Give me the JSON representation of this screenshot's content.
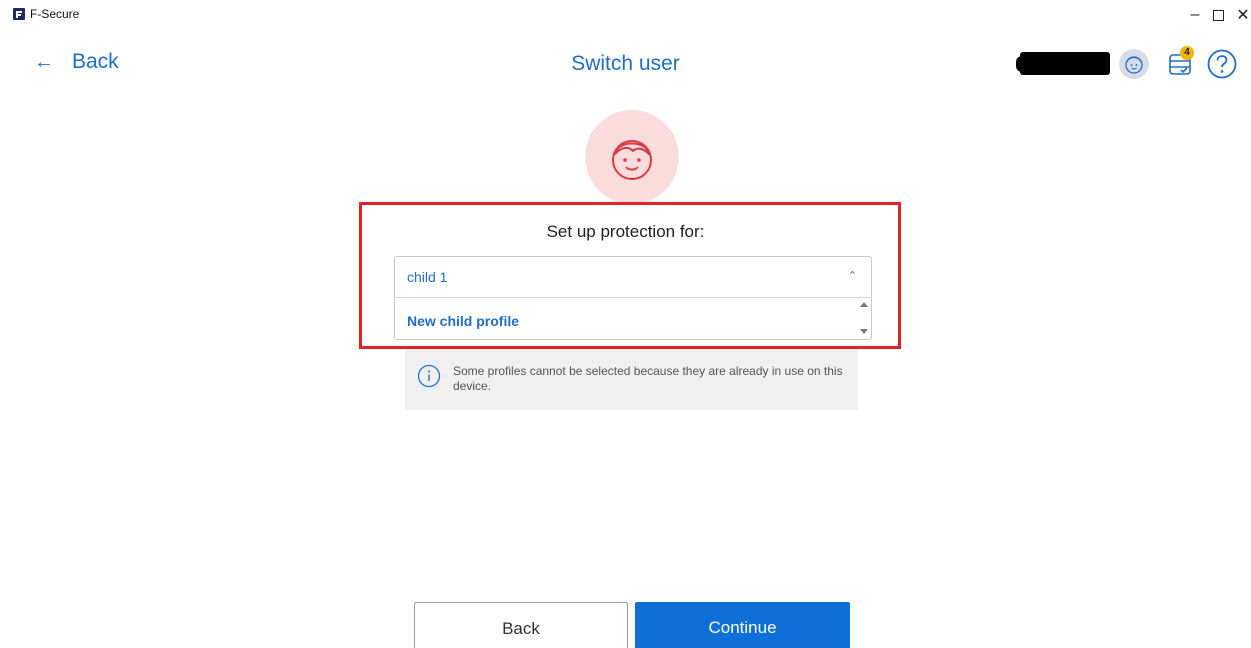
{
  "window": {
    "app_title": "F-Secure",
    "minimize_glyph": "–",
    "close_glyph": "✕"
  },
  "header": {
    "back_label": "Back",
    "back_arrow": "←",
    "title": "Switch user",
    "notification_count": "4",
    "icons": [
      "child-avatar-icon",
      "tasks-icon",
      "help-icon"
    ]
  },
  "form": {
    "setup_label": "Set up protection for:",
    "selected_value": "child 1",
    "options": [
      "New child profile"
    ]
  },
  "info": {
    "message": "Some profiles cannot be selected because they are already in use on this device."
  },
  "footer": {
    "back_button": "Back",
    "continue_button": "Continue"
  },
  "colors": {
    "accent": "#1f6fc5",
    "primary_button": "#0f6fd8",
    "highlight_border": "#e1222b",
    "hero_bg": "#fbdcdc",
    "badge": "#f5b400"
  }
}
